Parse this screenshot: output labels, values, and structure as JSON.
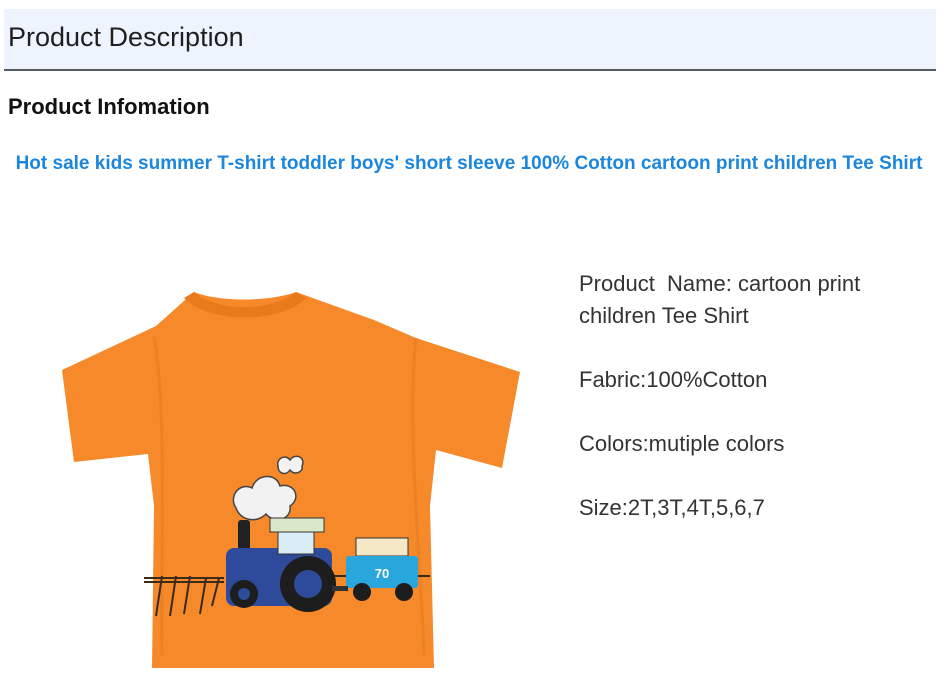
{
  "header": {
    "title": "Product Description"
  },
  "section": {
    "heading": "Product Infomation"
  },
  "product": {
    "title": "Hot sale kids summer T-shirt toddler boys' short sleeve 100% Cotton cartoon print children Tee Shirt",
    "image": {
      "icon": "tshirt-image",
      "shirt_color": "#f6892a",
      "badge_text": "70"
    }
  },
  "specs": [
    {
      "text": "Product  Name: cartoon print children Tee Shirt"
    },
    {
      "text": "Fabric:100%Cotton"
    },
    {
      "text": "Colors:mutiple colors"
    },
    {
      "text": "Size:2T,3T,4T,5,6,7"
    }
  ]
}
